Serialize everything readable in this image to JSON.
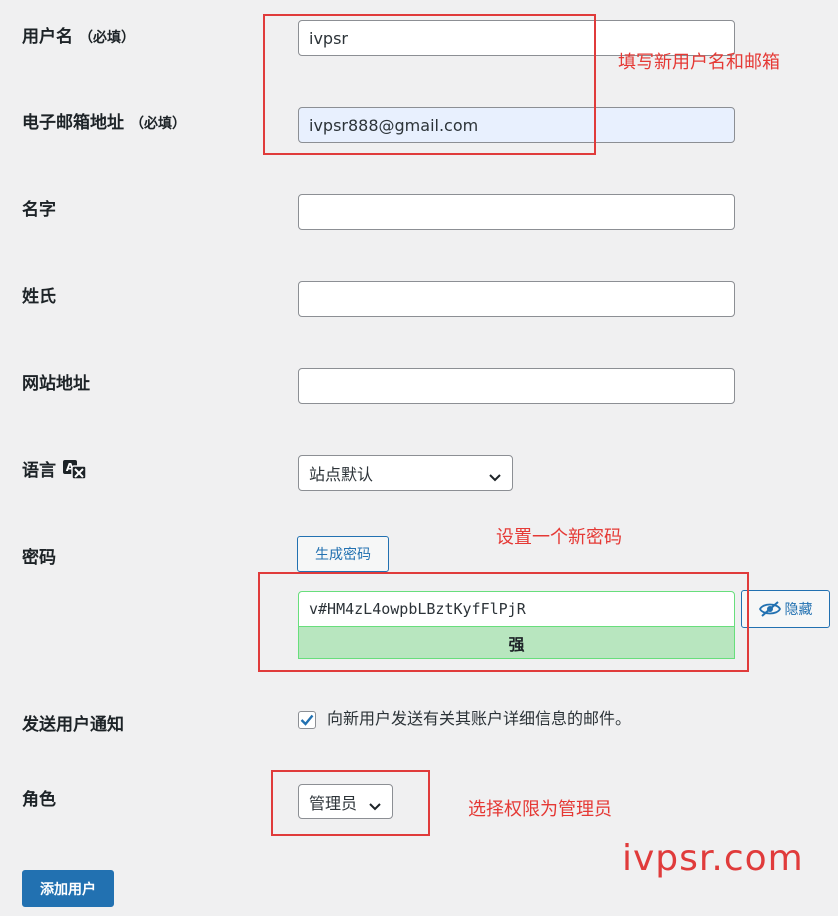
{
  "form": {
    "username": {
      "label": "用户名",
      "required": "（必填）",
      "value": "ivpsr"
    },
    "email": {
      "label": "电子邮箱地址",
      "required": "（必填）",
      "value": "ivpsr888@gmail.com"
    },
    "first_name": {
      "label": "名字",
      "value": ""
    },
    "last_name": {
      "label": "姓氏",
      "value": ""
    },
    "website": {
      "label": "网站地址",
      "value": ""
    },
    "language": {
      "label": "语言",
      "selected": "站点默认",
      "icon": "translation-icon"
    },
    "password": {
      "label": "密码",
      "generate_button": "生成密码",
      "value": "v#HM4zL4owpbLBztKyfFlPjR",
      "strength": "强",
      "hide_button": "隐藏",
      "hide_icon": "eye-slash-icon"
    },
    "notification": {
      "label": "发送用户通知",
      "checkbox_text": "向新用户发送有关其账户详细信息的邮件。",
      "checked": true
    },
    "role": {
      "label": "角色",
      "selected": "管理员"
    },
    "submit_button": "添加用户"
  },
  "annotations": {
    "user_email_note": "填写新用户名和邮箱",
    "password_note": "设置一个新密码",
    "role_note": "选择权限为管理员",
    "watermark": "ivpsr.com",
    "color": "#e53935"
  },
  "colors": {
    "accent": "#2271b1",
    "background": "#f0f0f1",
    "strength_good": "#b8e6bf"
  }
}
